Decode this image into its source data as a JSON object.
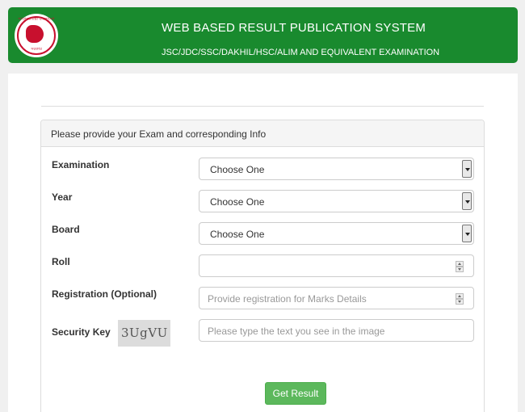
{
  "header": {
    "title": "WEB BASED RESULT PUBLICATION SYSTEM",
    "subtitle": "JSC/JDC/SSC/DAKHIL/HSC/ALIM AND EQUIVALENT EXAMINATION",
    "logo_text_top": "গণপ্রজাতন্ত্রী বাংলাদেশ",
    "logo_text_bottom": "সরকার",
    "colors": {
      "header_bg": "#198a2e",
      "logo_red": "#c8102e"
    }
  },
  "form": {
    "panel_heading": "Please provide your Exam and corresponding Info",
    "examination": {
      "label": "Examination",
      "value": "Choose One"
    },
    "year": {
      "label": "Year",
      "value": "Choose One"
    },
    "board": {
      "label": "Board",
      "value": "Choose One"
    },
    "roll": {
      "label": "Roll",
      "value": ""
    },
    "registration": {
      "label": "Registration (Optional)",
      "placeholder": "Provide registration for Marks Details"
    },
    "security_key": {
      "label": "Security Key",
      "captcha": "3UgVU",
      "placeholder": "Please type the text you see in the image"
    },
    "submit_label": "Get Result",
    "colors": {
      "button_bg": "#5cb85c"
    }
  }
}
